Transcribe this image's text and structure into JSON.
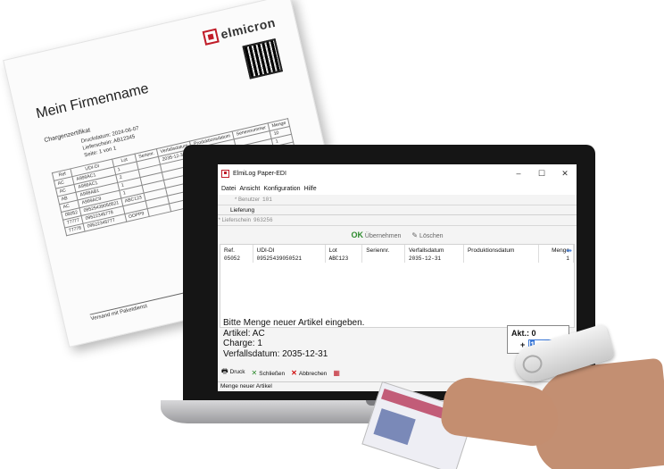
{
  "certificate": {
    "logo_text": "elmicron",
    "company": "Mein Firmenname",
    "title": "Chargenzertifikat",
    "meta": [
      "Druckdatum:  2024-06-07",
      "Lieferschein:  AB12345",
      "Seite:  1 von 1"
    ],
    "headers": [
      "Ref",
      "UDI-DI",
      "Lot",
      "Serienr.",
      "Verfallsdatum",
      "Produktionsdatum",
      "Seriennummer",
      "Menge"
    ],
    "rows": [
      [
        "AC",
        "A999AC1",
        "1",
        "",
        "2035-12-31",
        "",
        "",
        "10"
      ],
      [
        "AC",
        "A999AC1",
        "2",
        "",
        "",
        "",
        "",
        "1"
      ],
      [
        "AB",
        "A999AB1",
        "1",
        "",
        "",
        "",
        "",
        "1"
      ],
      [
        "AC",
        "A999AC9",
        "1",
        "",
        "",
        "",
        "",
        "10"
      ],
      [
        "05052",
        "09525439050521",
        "ABC123",
        "",
        "",
        "",
        "",
        ""
      ],
      [
        "77777",
        "09522345778",
        "",
        "",
        "",
        "",
        "",
        ""
      ],
      [
        "77778",
        "09522345777",
        "OOPP9",
        "",
        "",
        "",
        "",
        ""
      ]
    ],
    "shipping": "Versand mit Paketdienst"
  },
  "app": {
    "title": "ElmiLog Paper-EDI",
    "window_controls": [
      "–",
      "☐",
      "✕"
    ],
    "menu": [
      "Datei",
      "Ansicht",
      "Konfiguration",
      "Hilfe"
    ],
    "benutzer_label": "* Benutzer",
    "benutzer_value": "101",
    "lieferung_label": "Lieferung",
    "lieferschein_label": "* Lieferschein",
    "lieferschein_value": "963256",
    "uebernehmen_label": "Übernehmen",
    "ok_glyph": "OK",
    "loeschen_label": "Löschen",
    "table": {
      "headers": [
        "Ref.",
        "UDI-DI",
        "Lot",
        "Seriennr.",
        "Verfallsdatum",
        "Produktionsdatum",
        "Menge"
      ],
      "rows": [
        [
          "05052",
          "09525439050521",
          "ABC123",
          "",
          "2035-12-31",
          "",
          "1"
        ]
      ]
    },
    "prompt": {
      "line1": "Bitte Menge neuer Artikel eingeben.",
      "line2": "Artikel: AC",
      "line3": "Charge: 1",
      "line4": "Verfallsdatum: 2035-12-31"
    },
    "akt": {
      "label": "Akt.:",
      "value": "0",
      "plus": "+",
      "input": "1"
    },
    "buttons": {
      "druck": "Druck",
      "schliessen": "Schließen",
      "abbrechen": "Abbrechen"
    },
    "status": "Menge neuer Artikel"
  },
  "colors": {
    "brand": "#c01c28",
    "accent": "#3a78d8"
  }
}
